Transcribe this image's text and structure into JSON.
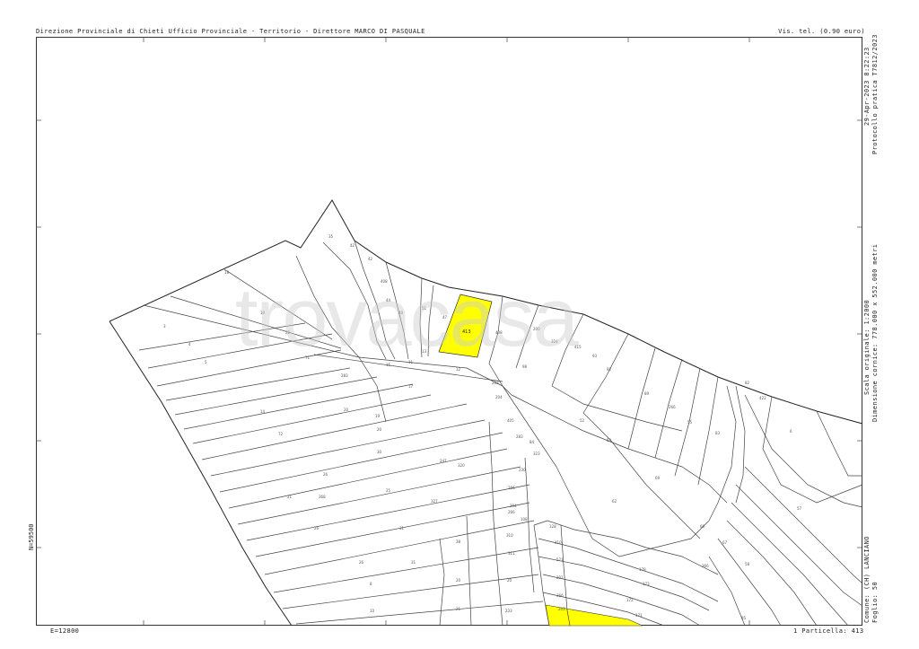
{
  "header": {
    "left": "Direzione Provinciale di Chieti  Ufficio Provinciale - Territorio - Direttore MARCO DI PASQUALE",
    "right": "Vis. tel. (0.90 euro)"
  },
  "side": {
    "date": "29-Apr-2023 8:22:23",
    "protocol": "Protocollo pratica T7812/2023",
    "scale": "Scala originale: 1:2000",
    "dimension": "Dimensione cornice: 778.000 x 552.000 metri",
    "comune": "Comune: (CH) LANCIANO",
    "foglio": "Foglio: 50"
  },
  "footer": {
    "left": "E=12800",
    "right": "1 Particella: 413"
  },
  "coordinate_n": "N=59500",
  "watermark": "trovacasa",
  "highlighted_parcel": {
    "label": "413",
    "color": "#ffff00"
  },
  "parcel_labels": [
    "413",
    "11",
    "12",
    "13",
    "14",
    "15",
    "17",
    "18",
    "19",
    "20",
    "21",
    "22",
    "25",
    "26",
    "31",
    "35",
    "36",
    "40",
    "41",
    "42",
    "47",
    "48",
    "50",
    "51",
    "52",
    "55",
    "57",
    "60",
    "62",
    "67",
    "69",
    "71",
    "72",
    "82",
    "83",
    "84",
    "89",
    "92",
    "93",
    "94",
    "98",
    "100",
    "116",
    "119",
    "128",
    "137",
    "139",
    "149",
    "171",
    "172",
    "173",
    "178",
    "200",
    "212",
    "216",
    "228",
    "232",
    "247",
    "266",
    "283",
    "292",
    "320",
    "323",
    "327",
    "368",
    "408",
    "410",
    "413",
    "415",
    "521"
  ],
  "colors": {
    "line": "#444444",
    "highlight": "#ffff00",
    "watermark": "#cdcdcd"
  }
}
